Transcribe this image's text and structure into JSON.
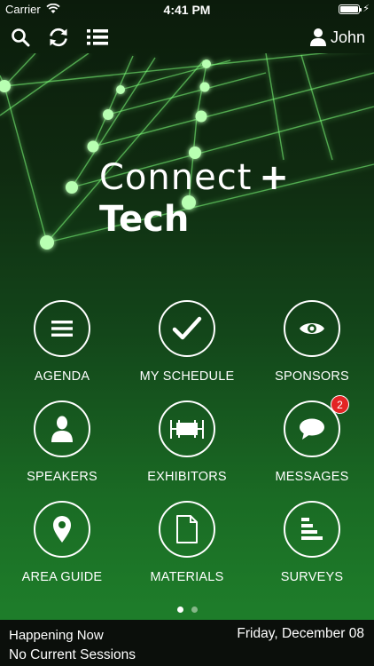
{
  "status_bar": {
    "carrier": "Carrier",
    "time": "4:41 PM",
    "battery_level": 1.0
  },
  "nav": {
    "icons": [
      "search-icon",
      "refresh-icon",
      "list-icon"
    ],
    "user_name": "John"
  },
  "brand": {
    "line1": "Connect",
    "plus": "+",
    "line2": "Tech"
  },
  "colors": {
    "background_top": "#0b1b0b",
    "background_bottom": "#1f7f2b",
    "accent_glow": "#7dff7a",
    "badge_red": "#e32424",
    "footer_bg": "#0b0f0b"
  },
  "tiles": [
    {
      "label": "AGENDA",
      "icon": "menu-icon"
    },
    {
      "label": "MY SCHEDULE",
      "icon": "checkmark-icon"
    },
    {
      "label": "SPONSORS",
      "icon": "eye-icon"
    },
    {
      "label": "SPEAKERS",
      "icon": "person-icon"
    },
    {
      "label": "EXHIBITORS",
      "icon": "booth-icon"
    },
    {
      "label": "MESSAGES",
      "icon": "chat-bubble-icon",
      "badge": "2"
    },
    {
      "label": "AREA GUIDE",
      "icon": "map-pin-icon"
    },
    {
      "label": "MATERIALS",
      "icon": "document-icon"
    },
    {
      "label": "SURVEYS",
      "icon": "bars-icon"
    }
  ],
  "pager": {
    "current_page": 1,
    "page_count": 2
  },
  "footer": {
    "title": "Happening Now",
    "subtitle": "No Current Sessions",
    "date": "Friday, December 08"
  }
}
